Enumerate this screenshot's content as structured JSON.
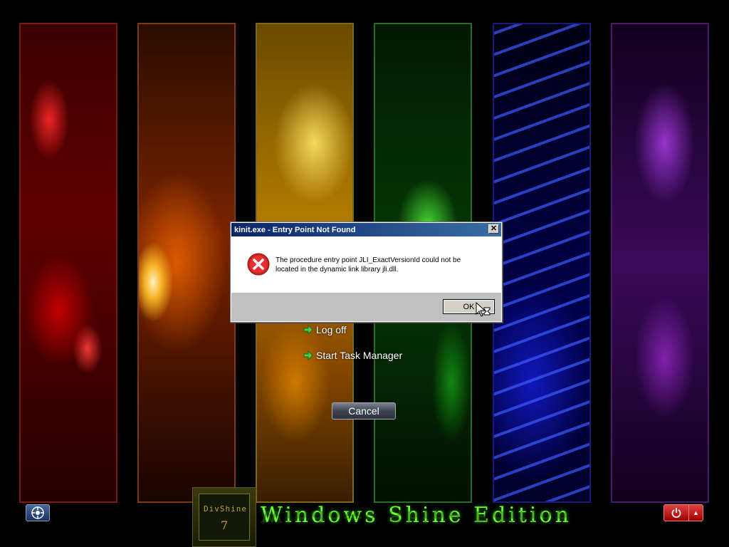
{
  "panels": [
    "red",
    "orange",
    "yellow",
    "green",
    "blue",
    "purple"
  ],
  "menu": {
    "log_off": "Log off",
    "task_manager": "Start Task Manager",
    "cancel": "Cancel"
  },
  "dialog": {
    "title": "kinit.exe - Entry Point Not Found",
    "close": "✕",
    "icon": "error-icon",
    "message_line1": "The procedure entry point JLI_ExactVersionId could not be",
    "message_line2": "located in the dynamic link library jli.dll.",
    "ok_label": "OK"
  },
  "bottom": {
    "logo_text": "DivShine",
    "logo_number": "7",
    "brand": "Windows Shine Edition",
    "ease_icon": "ease-of-access-icon",
    "power_icon": "power-icon",
    "arrow": "▲"
  }
}
